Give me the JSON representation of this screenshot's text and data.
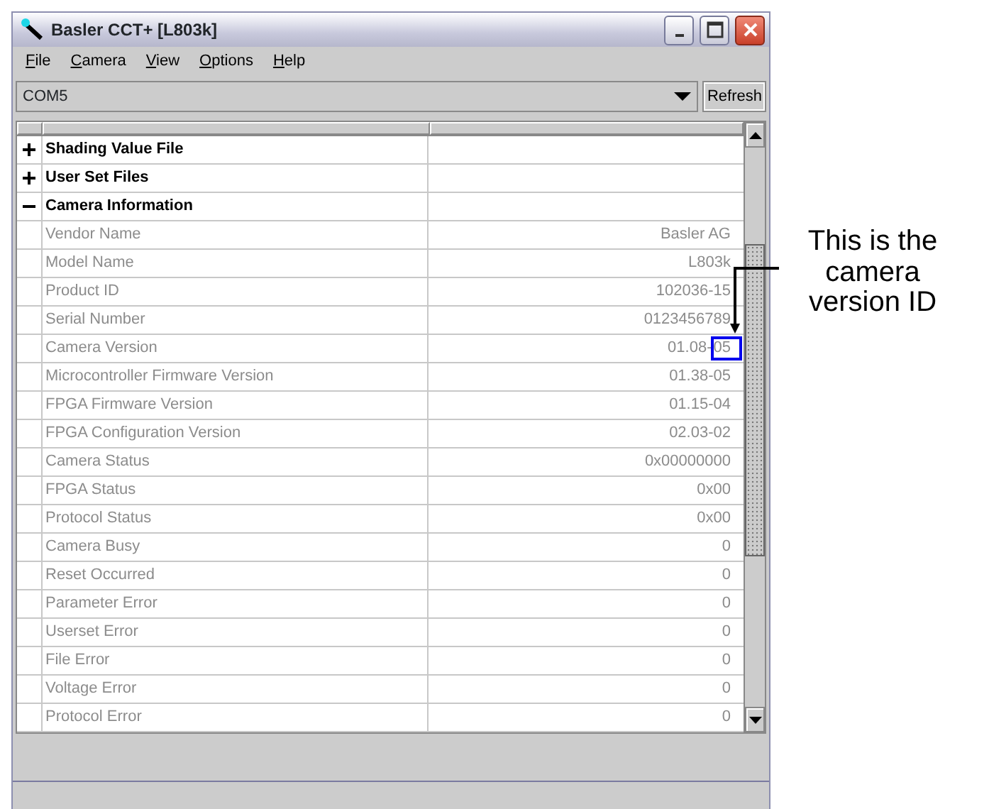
{
  "window": {
    "title": "Basler CCT+ [L803k]"
  },
  "menu": [
    {
      "label": "File"
    },
    {
      "label": "Camera"
    },
    {
      "label": "View"
    },
    {
      "label": "Options"
    },
    {
      "label": "Help"
    }
  ],
  "port": {
    "value": "COM5"
  },
  "refresh_button": "Refresh",
  "tree": [
    {
      "label": "Shading Value File",
      "expanded": false
    },
    {
      "label": "User Set Files",
      "expanded": false
    },
    {
      "label": "Camera Information",
      "expanded": true,
      "children": [
        {
          "name": "Vendor Name",
          "value": "Basler AG",
          "highlighted": false
        },
        {
          "name": "Model Name",
          "value": "L803k",
          "highlighted": false
        },
        {
          "name": "Product ID",
          "value": "102036-15",
          "highlighted": false
        },
        {
          "name": "Serial Number",
          "value": "0123456789",
          "highlighted": false
        },
        {
          "name": "Camera Version",
          "value": "01.08-05",
          "highlighted": true
        },
        {
          "name": "Microcontroller Firmware Version",
          "value": "01.38-05",
          "highlighted": false
        },
        {
          "name": "FPGA Firmware Version",
          "value": "01.15-04",
          "highlighted": false
        },
        {
          "name": "FPGA Configuration Version",
          "value": "02.03-02",
          "highlighted": false
        },
        {
          "name": "Camera Status",
          "value": "0x00000000",
          "highlighted": false
        },
        {
          "name": "FPGA Status",
          "value": "0x00",
          "highlighted": false
        },
        {
          "name": "Protocol Status",
          "value": "0x00",
          "highlighted": false
        },
        {
          "name": "Camera Busy",
          "value": "0",
          "highlighted": false
        },
        {
          "name": "Reset Occurred",
          "value": "0",
          "highlighted": false
        },
        {
          "name": "Parameter Error",
          "value": "0",
          "highlighted": false
        },
        {
          "name": "Userset Error",
          "value": "0",
          "highlighted": false
        },
        {
          "name": "File Error",
          "value": "0",
          "highlighted": false
        },
        {
          "name": "Voltage Error",
          "value": "0",
          "highlighted": false
        },
        {
          "name": "Protocol Error",
          "value": "0",
          "highlighted": false
        }
      ]
    }
  ],
  "annotation": {
    "text": "This is the camera version ID"
  }
}
